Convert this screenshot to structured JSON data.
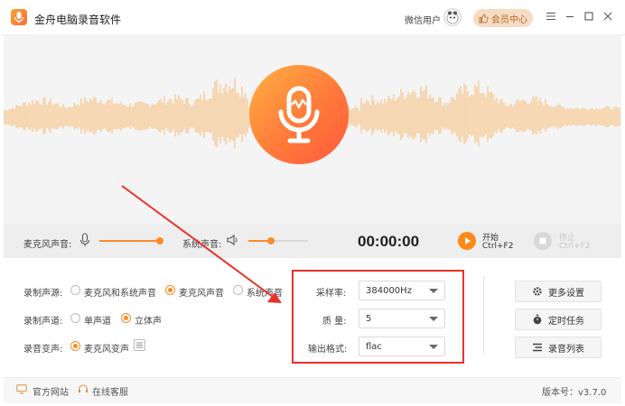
{
  "app": {
    "title": "金舟电脑录音软件"
  },
  "titlebar": {
    "user_label": "微信用户",
    "vip_label": "会员中心"
  },
  "controls": {
    "mic_volume_label": "麦克风声音:",
    "system_volume_label": "系统声音:",
    "mic_volume_level": 0.95,
    "system_volume_level": 0.38,
    "timer": "00:00:00",
    "start_label": "开始",
    "start_shortcut": "Ctrl+F2",
    "stop_label": "停止",
    "stop_shortcut": "Ctrl+F2"
  },
  "settings": {
    "source_label": "录制声源:",
    "source_options": [
      "麦克风和系统声音",
      "麦克风声音",
      "系统声音"
    ],
    "source_selected": 1,
    "channel_label": "录制声道:",
    "channel_options": [
      "单声道",
      "立体声"
    ],
    "channel_selected": 1,
    "voice_change_label": "录音变声:",
    "voice_change_option": "麦克风变声",
    "sample_rate_label": "采样率:",
    "sample_rate_value": "384000Hz",
    "quality_label": "质 量:",
    "quality_value": "5",
    "format_label": "输出格式:",
    "format_value": "flac"
  },
  "side_buttons": {
    "more_settings": "更多设置",
    "timed_task": "定时任务",
    "record_list": "录音列表"
  },
  "footer": {
    "website": "官方网站",
    "support": "在线客服",
    "version": "版本号：v3.7.0"
  },
  "colors": {
    "accent": "#ff8a1a",
    "wave": "#f7c48a",
    "highlight_box": "#e8322c"
  }
}
